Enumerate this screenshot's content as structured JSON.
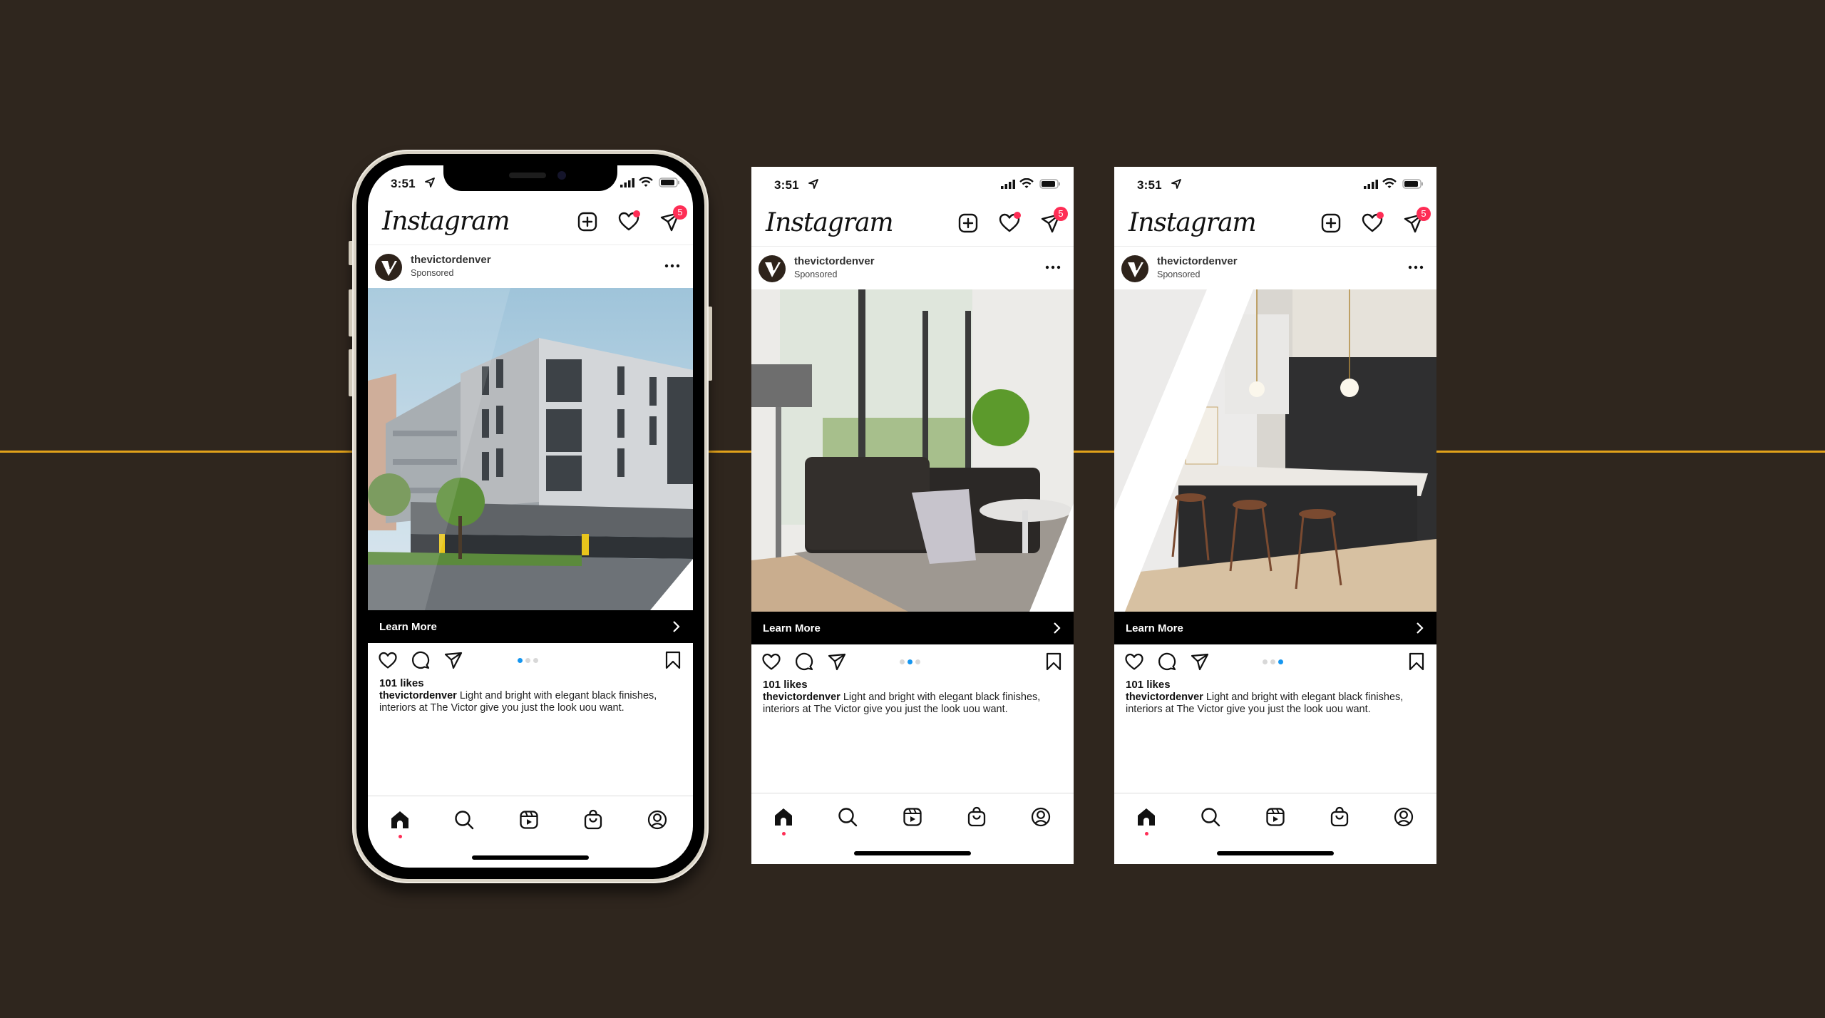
{
  "background_color": "#2f261e",
  "accent_line_color": "#e2a21a",
  "screens": [
    {
      "id": "phone-1",
      "status": {
        "time": "3:51"
      },
      "app": {
        "logo": "Instagram",
        "dm_badge_count": "5"
      },
      "post": {
        "username": "thevictordenver",
        "sponsored_label": "Sponsored",
        "image_subject": "modern apartment building exterior",
        "cta_label": "Learn More",
        "carousel": {
          "count": 3,
          "active_index": 0
        },
        "likes": "101 likes",
        "caption_user": "thevictordenver",
        "caption_text": " Light and bright with elegant black finishes, interiors at The Victor give you just the look uou want."
      },
      "nav": [
        "home-icon",
        "search-icon",
        "reels-icon",
        "shop-icon",
        "profile-icon"
      ],
      "nav_active": "home-icon"
    },
    {
      "id": "phone-2",
      "status": {
        "time": "3:51"
      },
      "app": {
        "logo": "Instagram",
        "dm_badge_count": "5"
      },
      "post": {
        "username": "thevictordenver",
        "sponsored_label": "Sponsored",
        "image_subject": "living room with dark sofa",
        "cta_label": "Learn More",
        "carousel": {
          "count": 3,
          "active_index": 1
        },
        "likes": "101 likes",
        "caption_user": "thevictordenver",
        "caption_text": " Light and bright with elegant black finishes, interiors at The Victor give you just the look uou want."
      },
      "nav": [
        "home-icon",
        "search-icon",
        "reels-icon",
        "shop-icon",
        "profile-icon"
      ],
      "nav_active": "home-icon"
    },
    {
      "id": "phone-3",
      "status": {
        "time": "3:51"
      },
      "app": {
        "logo": "Instagram",
        "dm_badge_count": "5"
      },
      "post": {
        "username": "thevictordenver",
        "sponsored_label": "Sponsored",
        "image_subject": "kitchen with black cabinets and bar stools",
        "cta_label": "Learn More",
        "carousel": {
          "count": 3,
          "active_index": 2
        },
        "likes": "101 likes",
        "caption_user": "thevictordenver",
        "caption_text": " Light and bright with elegant black finishes, interiors at The Victor give you just the look uou want."
      },
      "nav": [
        "home-icon",
        "search-icon",
        "reels-icon",
        "shop-icon",
        "profile-icon"
      ],
      "nav_active": "home-icon"
    }
  ],
  "colors": {
    "notification_red": "#fe2d55",
    "carousel_active": "#1596f0",
    "carousel_inactive": "#d8d8d8",
    "cta_bar": "#000000",
    "avatar_bg": "#2e231b"
  }
}
